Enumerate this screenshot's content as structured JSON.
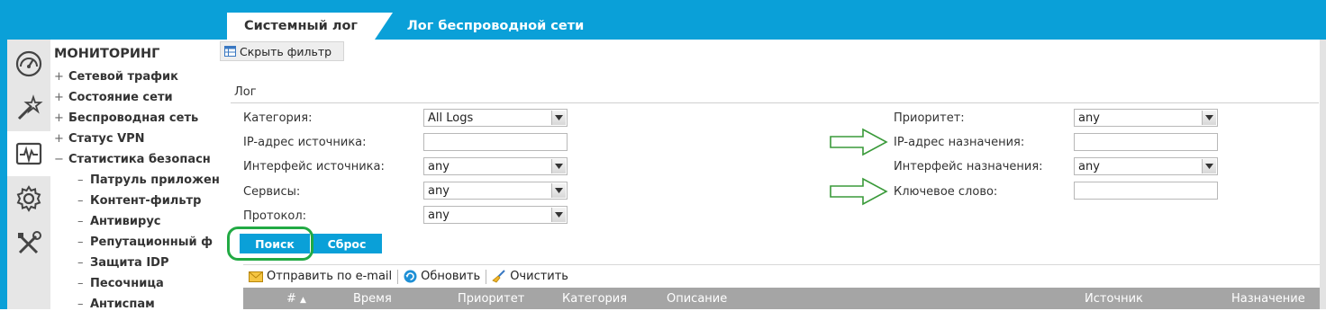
{
  "tabs": [
    "Системный лог",
    "Лог беспроводной сети"
  ],
  "filter_toggle": "Скрыть фильтр",
  "sidebar": {
    "heading": "МОНИТОРИНГ",
    "items": [
      {
        "prefix": "+",
        "label": "Сетевой трафик"
      },
      {
        "prefix": "+",
        "label": "Состояние сети"
      },
      {
        "prefix": "+",
        "label": "Беспроводная сеть"
      },
      {
        "prefix": "+",
        "label": "Статус VPN"
      },
      {
        "prefix": "−",
        "label": "Статистика безопасн"
      }
    ],
    "subitems": [
      "Патруль приложен",
      "Контент-фильтр",
      "Антивирус",
      "Репутационный ф",
      "Защита IDP",
      "Песочница",
      "Антиспам"
    ]
  },
  "log_section": {
    "title": "Лог",
    "left": {
      "category_label": "Категория:",
      "category_value": "All Logs",
      "src_ip_label": "IP-адрес источника:",
      "src_ip_value": "",
      "src_if_label": "Интерфейс источника:",
      "src_if_value": "any",
      "services_label": "Сервисы:",
      "services_value": "any",
      "protocol_label": "Протокол:",
      "protocol_value": "any"
    },
    "right": {
      "priority_label": "Приоритет:",
      "priority_value": "any",
      "dst_ip_label": "IP-адрес назначения:",
      "dst_ip_value": "",
      "dst_if_label": "Интерфейс назначения:",
      "dst_if_value": "any",
      "keyword_label": "Ключевое слово:",
      "keyword_value": ""
    },
    "search_button": "Поиск",
    "reset_button": "Сброс"
  },
  "toolbar": {
    "email": "Отправить по e-mail",
    "refresh": "Обновить",
    "clear": "Очистить"
  },
  "table": {
    "columns": [
      "#",
      "Время",
      "Приоритет",
      "Категория",
      "Описание",
      "Источник",
      "Назначение"
    ],
    "sort_indicator": "▲"
  },
  "colors": {
    "accent": "#0aa0d8",
    "highlight": "#22aa44",
    "annotation_arrow": "#3a9a3a"
  },
  "icons": [
    "gauge-icon",
    "wand-icon",
    "pulse-monitor-icon",
    "gear-icon",
    "tools-icon",
    "table-icon",
    "envelope-icon",
    "refresh-icon",
    "broom-icon"
  ]
}
